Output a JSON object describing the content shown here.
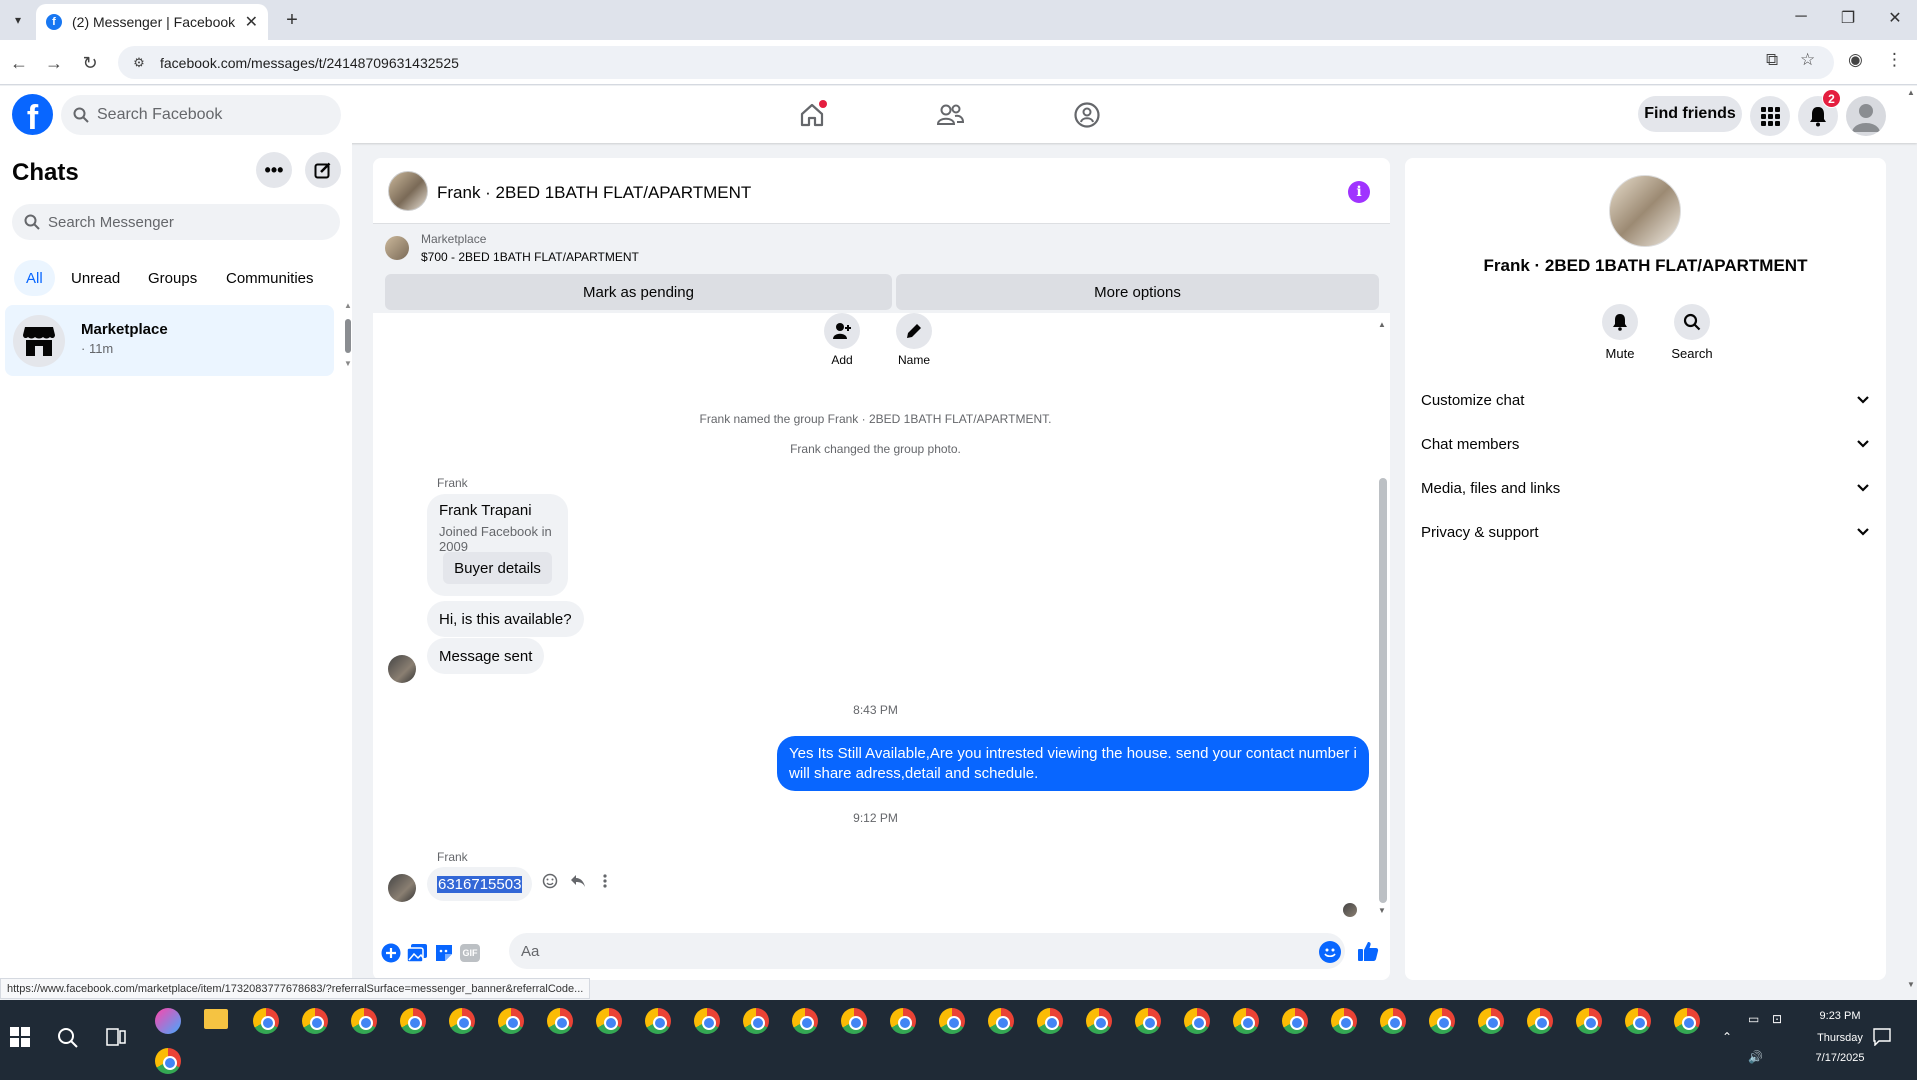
{
  "browser": {
    "tab_title": "(2) Messenger | Facebook",
    "url": "facebook.com/messages/t/24148709631432525",
    "status_url": "https://www.facebook.com/marketplace/item/1732083777678683/?referralSurface=messenger_banner&referralCode..."
  },
  "fb_header": {
    "search_placeholder": "Search Facebook",
    "find_friends_label": "Find friends",
    "notification_count": "2"
  },
  "chats": {
    "title": "Chats",
    "search_placeholder": "Search Messenger",
    "filters": [
      "All",
      "Unread",
      "Groups",
      "Communities"
    ],
    "active_filter": "All",
    "items": [
      {
        "name": "Marketplace",
        "time": "· 11m"
      }
    ]
  },
  "conversation": {
    "title": "Frank · 2BED 1BATH FLAT/APARTMENT",
    "marketplace_label": "Marketplace",
    "listing": "$700 - 2BED 1BATH FLAT/APARTMENT",
    "mark_pending_label": "Mark as pending",
    "more_options_label": "More options",
    "add_label": "Add",
    "name_label": "Name",
    "system_messages": [
      "Frank named the group Frank · 2BED 1BATH FLAT/APARTMENT.",
      "Frank changed the group photo."
    ],
    "sender_name": "Frank",
    "card": {
      "name": "Frank Trapani",
      "subtitle": "Joined Facebook in 2009",
      "button": "Buyer details"
    },
    "incoming_1": "Hi, is this available?",
    "incoming_2": "Message sent",
    "time_1": "8:43 PM",
    "outgoing": "Yes Its Still Available,Are you intrested viewing the house. send your contact number i will share adress,detail and schedule.",
    "time_2": "9:12 PM",
    "phone": "6316715503",
    "composer_placeholder": "Aa",
    "gif_label": "GIF"
  },
  "info_panel": {
    "title": "Frank · 2BED 1BATH FLAT/APARTMENT",
    "mute_label": "Mute",
    "search_label": "Search",
    "sections": [
      "Customize chat",
      "Chat members",
      "Media, files and links",
      "Privacy & support"
    ]
  },
  "taskbar": {
    "time": "9:23 PM",
    "day": "Thursday",
    "date": "7/17/2025"
  },
  "colors": {
    "accent": "#0866ff",
    "info_purple": "#a033ff",
    "badge_red": "#e41e3f"
  }
}
